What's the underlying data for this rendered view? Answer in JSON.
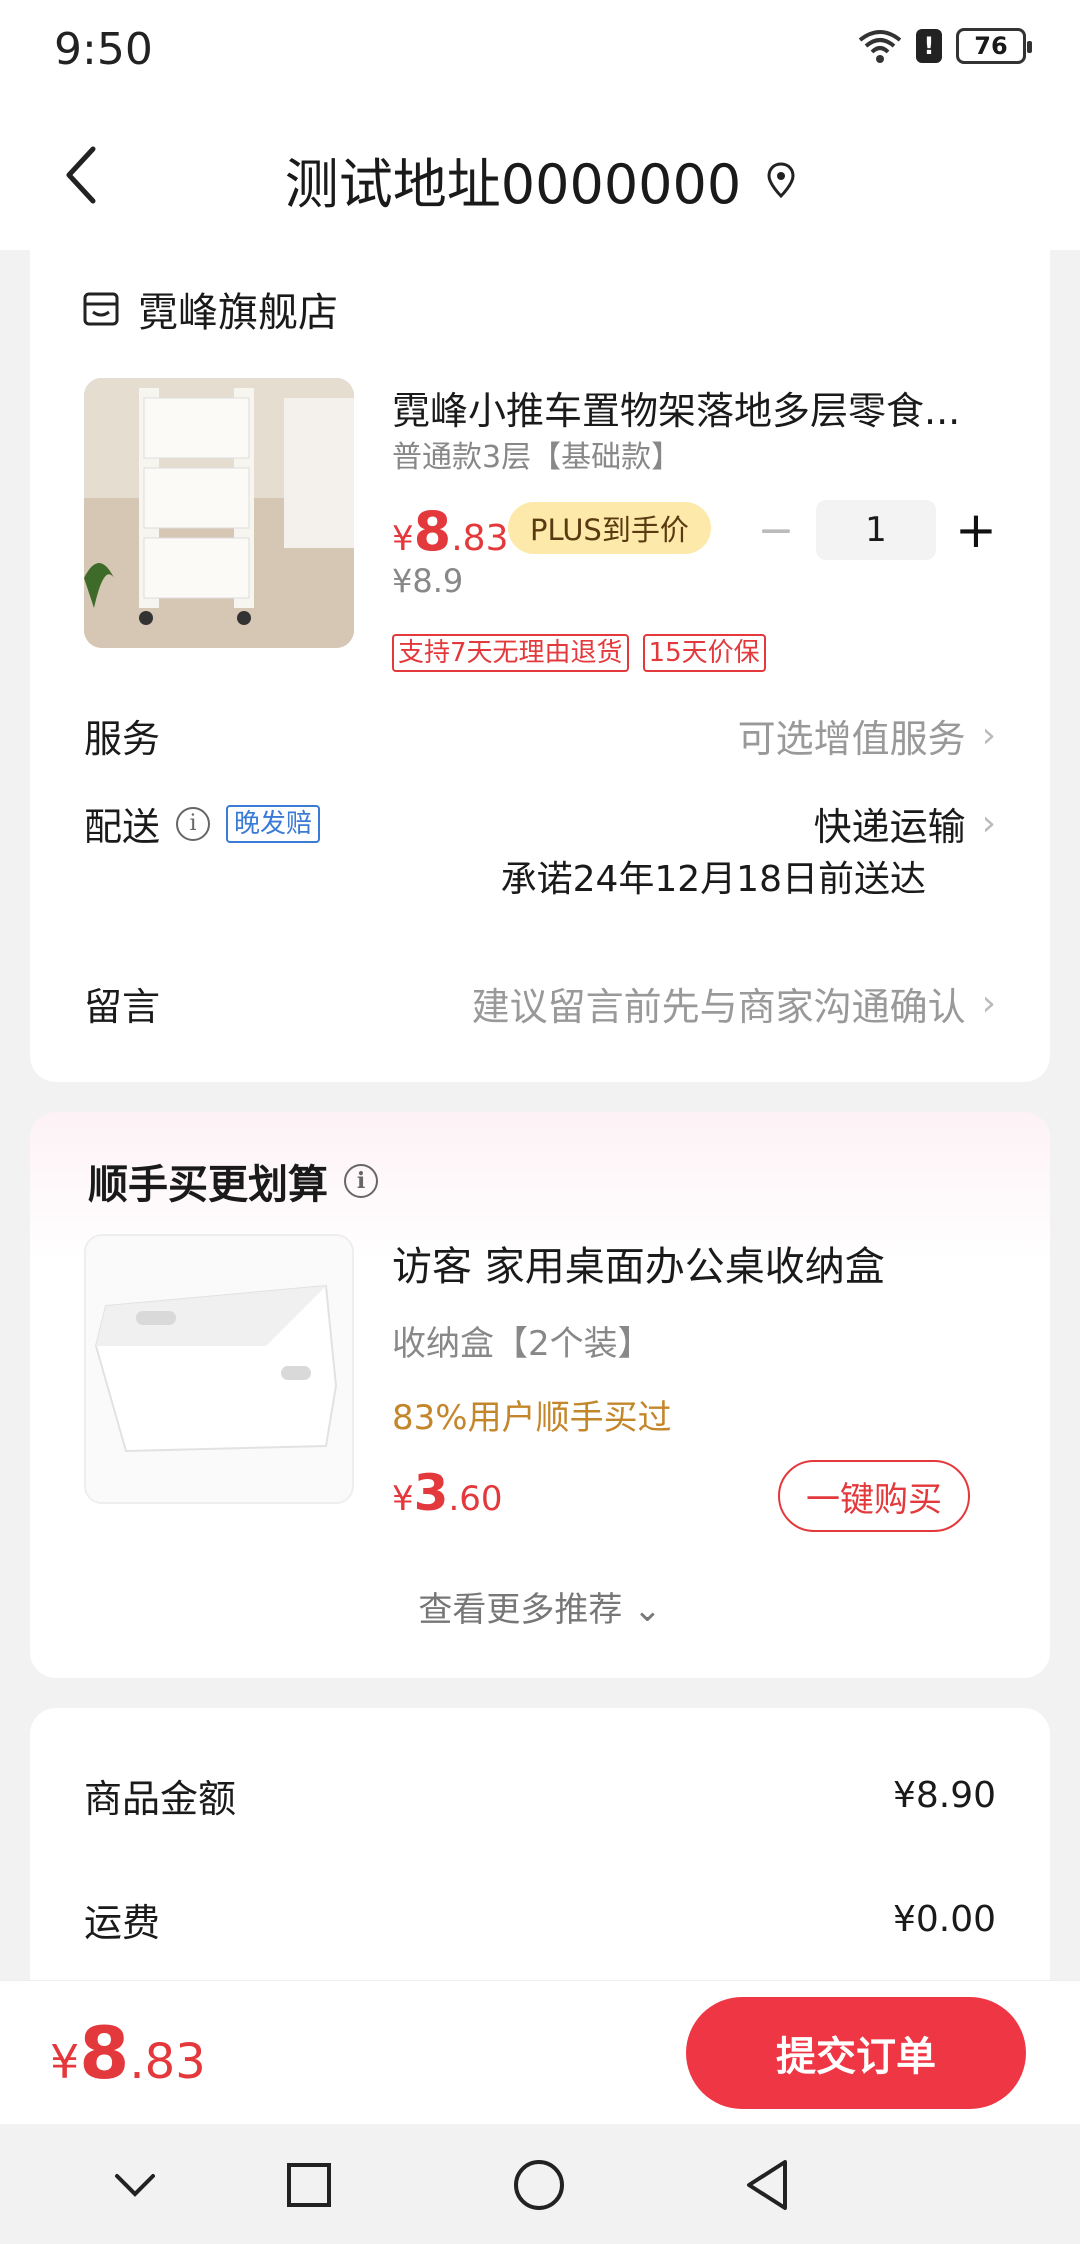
{
  "status_bar": {
    "time": "9:50",
    "battery": "76",
    "alert": "!"
  },
  "header": {
    "title": "测试地址0000000"
  },
  "shop": {
    "name": "霓峰旗舰店"
  },
  "product": {
    "title": "霓峰小推车置物架落地多层零食...",
    "spec": "普通款3层【基础款】",
    "price_yen": "¥",
    "price_int": "8",
    "price_dec": ".83",
    "plus_label": "PLUS到手价",
    "original_price": "¥8.9",
    "quantity": "1",
    "minus": "−",
    "plus": "+",
    "tags": [
      "支持7天无理由退货",
      "15天价保"
    ]
  },
  "service": {
    "label": "服务",
    "value": "可选增值服务"
  },
  "delivery": {
    "label": "配送",
    "info": "i",
    "late_tag": "晚发赔",
    "value": "快递运输",
    "promise": "承诺24年12月18日前送达"
  },
  "message": {
    "label": "留言",
    "placeholder": "建议留言前先与商家沟通确认"
  },
  "chevron": "›",
  "recommend": {
    "title": "顺手买更划算",
    "info": "i",
    "item_name": "访客 家用桌面办公桌收纳盒",
    "item_spec": "收纳盒【2个装】",
    "hint": "83%用户顺手买过",
    "price_yen": "¥",
    "price_int": "3",
    "price_dec": ".60",
    "buy_label": "一键购买",
    "more_label": "查看更多推荐 ⌄"
  },
  "summary": {
    "goods_label": "商品金额",
    "goods_value": "¥8.90",
    "shipping_label": "运费",
    "shipping_value": "¥0.00"
  },
  "footer": {
    "total_yen": "¥",
    "total_int": "8",
    "total_dec": ".83",
    "submit_label": "提交订单"
  },
  "colors": {
    "accent": "#e4393c",
    "submit": "#ee3644",
    "plus_tag": "#fde9a9",
    "hint": "#c4862a",
    "late_tag": "#3a7bd5"
  },
  "icons": [
    "back-icon",
    "location-pin-icon",
    "shop-icon",
    "info-icon",
    "chevron-right-icon",
    "wifi-icon",
    "battery-icon",
    "nav-down-icon",
    "nav-recents-icon",
    "nav-home-icon",
    "nav-back-icon"
  ]
}
